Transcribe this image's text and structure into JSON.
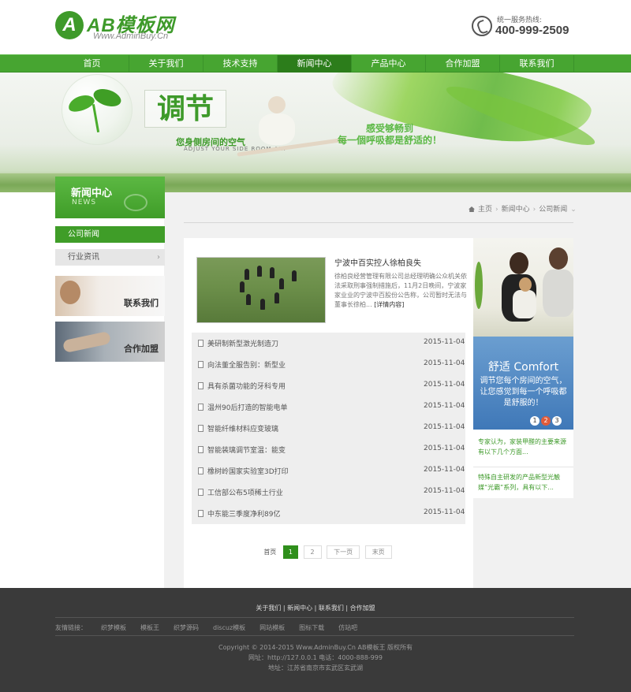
{
  "header": {
    "logo_mark": "A",
    "logo_text": "AB模板网",
    "logo_sub": "Www.AdminBuy.Cn",
    "hotline_label": "统一服务热线:",
    "hotline_number": "400-999-2509"
  },
  "nav": {
    "items": [
      "首页",
      "关于我们",
      "技术支持",
      "新闻中心",
      "产品中心",
      "合作加盟",
      "联系我们"
    ],
    "active_index": 3
  },
  "banner": {
    "title": "调节",
    "subtitle": "您身侧房间的空气",
    "subtitle_en": "ADJUST YOUR SIDE ROOM AIR",
    "slogan_line1": "感受够畅到",
    "slogan_line2": "每一個呼吸都是舒适的！"
  },
  "sidebar": {
    "title": "新闻中心",
    "title_en": "NEWS",
    "items": [
      "公司新闻",
      "行业资讯"
    ],
    "ad_contact": "联系我们",
    "ad_join": "合作加盟"
  },
  "breadcrumb": {
    "items": [
      "主页",
      "新闻中心",
      "公司新闻"
    ],
    "separator": "›"
  },
  "featured": {
    "title": "宁波中百实控人徐柏良失",
    "text": "徐柏良经营管理有限公司总经理明确公众机关依法采取刑事强制措施后，11月2日晚间，宁波家家业业的宁波中百股份公告称，公司暂时无法与董事长徐柏...",
    "more": "[详情内容]"
  },
  "news_list": [
    {
      "title": "美研制新型激光制造刀",
      "date": "2015-11-04"
    },
    {
      "title": "向法董全服告别：新型业",
      "date": "2015-11-04"
    },
    {
      "title": "具有杀菌功能的牙科专用",
      "date": "2015-11-04"
    },
    {
      "title": "温州90后打造的智能电单",
      "date": "2015-11-04"
    },
    {
      "title": "智能纤维材料应变玻璃",
      "date": "2015-11-04"
    },
    {
      "title": "智能装璃调节室温：能变",
      "date": "2015-11-04"
    },
    {
      "title": "橡树岭国家实验室3D打印",
      "date": "2015-11-04"
    },
    {
      "title": "工信部公布5项稀土行业",
      "date": "2015-11-04"
    },
    {
      "title": "中东能三季度净利89亿",
      "date": "2015-11-04"
    }
  ],
  "pagination": {
    "label": "首页",
    "current": "1",
    "page2": "2",
    "next": "下一页",
    "last": "末页"
  },
  "right_ad": {
    "title": "舒适 Comfort",
    "text": "调节您每个房间的空气，让您感觉到每一个呼吸都是舒服的！",
    "dots": [
      "1",
      "2",
      "3"
    ],
    "active_dot": 1
  },
  "right_news": [
    "专家认为，家装甲醛的主要来源有以下几个方面...",
    "特殊自主研发的产品新型光触媒“光霸”系列，具有以下..."
  ],
  "footer": {
    "links": [
      "关于我们",
      "新闻中心",
      "联系我们",
      "合作加盟"
    ],
    "link_sep": " | ",
    "friends_label": "友情链接：",
    "friends": [
      "织梦模板",
      "模板王",
      "织梦源码",
      "discuz模板",
      "网站模板",
      "图标下载",
      "仿站吧"
    ],
    "copyright": "Copyright © 2014-2015 Www.AdminBuy.Cn AB模板王 版权所有",
    "site": "网址：http://127.0.0.1    电话：4000-888-999",
    "address": "地址：江苏省南京市玄武区玄武湖"
  }
}
